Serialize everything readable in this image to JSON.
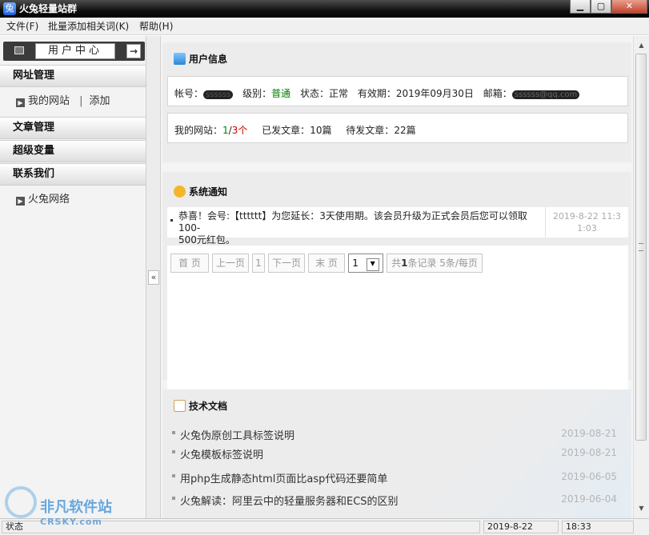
{
  "window": {
    "title": "火兔轻量站群",
    "buttons": {
      "min": "▁",
      "max": "▢",
      "close": "✕"
    }
  },
  "menu": [
    "文件(F)",
    "批量添加相关词(K)",
    "帮助(H)"
  ],
  "sidebar": {
    "user_center": "用户中心",
    "sections": [
      {
        "title": "网址管理",
        "subitems": [
          "我的网站",
          "添加"
        ],
        "separator": "|"
      },
      {
        "title": "文章管理"
      },
      {
        "title": "超级变量"
      },
      {
        "title": "联系我们",
        "subitems": [
          "火兔网络"
        ]
      }
    ]
  },
  "user_info": {
    "title": "用户信息",
    "account_label": "帐号：",
    "account_value": "ssssss",
    "level_label": "级别：",
    "level_value": "普通",
    "status_label": "状态：",
    "status_value": "正常",
    "expiry_label": "有效期：",
    "expiry_value": "2019年09月30日",
    "email_label": "邮箱：",
    "email_value": "ssssss@qq.com",
    "sites_label": "我的网站：",
    "sites_used": "1",
    "sites_sep": "/",
    "sites_total": "3个",
    "posted_label": "已发文章：",
    "posted_value": "10篇",
    "pending_label": "待发文章：",
    "pending_value": "22篇",
    "colors": {
      "level": "#008000",
      "sites_used": "#008000",
      "sites_total": "#cc0000"
    }
  },
  "notice": {
    "title": "系统通知",
    "items": [
      {
        "text_a": "恭喜！会号:【tttttt】为您延长：3天使用期。该会员升级为正式会员后您可以领取100-",
        "text_b": "500元红包。",
        "date_a": "2019-8-22 11:3",
        "date_b": "1:03"
      }
    ],
    "pager": {
      "first": "首 页",
      "prev": "上一页",
      "current": "1",
      "next": "下一页",
      "last": "末 页",
      "select": "1",
      "summary_prefix": "共",
      "summary_count": "1",
      "summary_suffix": "条记录 5条/每页"
    }
  },
  "docs": {
    "title": "技术文档",
    "items": [
      {
        "title": "火兔伪原创工具标签说明",
        "date": "2019-08-21"
      },
      {
        "title": "火兔模板标签说明",
        "date": "2019-08-21"
      },
      {
        "title": "用php生成静态html页面比asp代码还要简单",
        "date": "2019-06-05"
      },
      {
        "title": "火兔解读：阿里云中的轻量服务器和ECS的区别",
        "date": "2019-06-04"
      }
    ]
  },
  "statusbar": {
    "label": "状态",
    "date": "2019-8-22",
    "time": "18:33"
  },
  "watermark": {
    "line1": "非凡软件站",
    "line2": "CRSKY.com"
  },
  "icons": {
    "user": "user-card-icon",
    "notice": "speech-bubble-icon",
    "docs": "document-edit-icon"
  }
}
